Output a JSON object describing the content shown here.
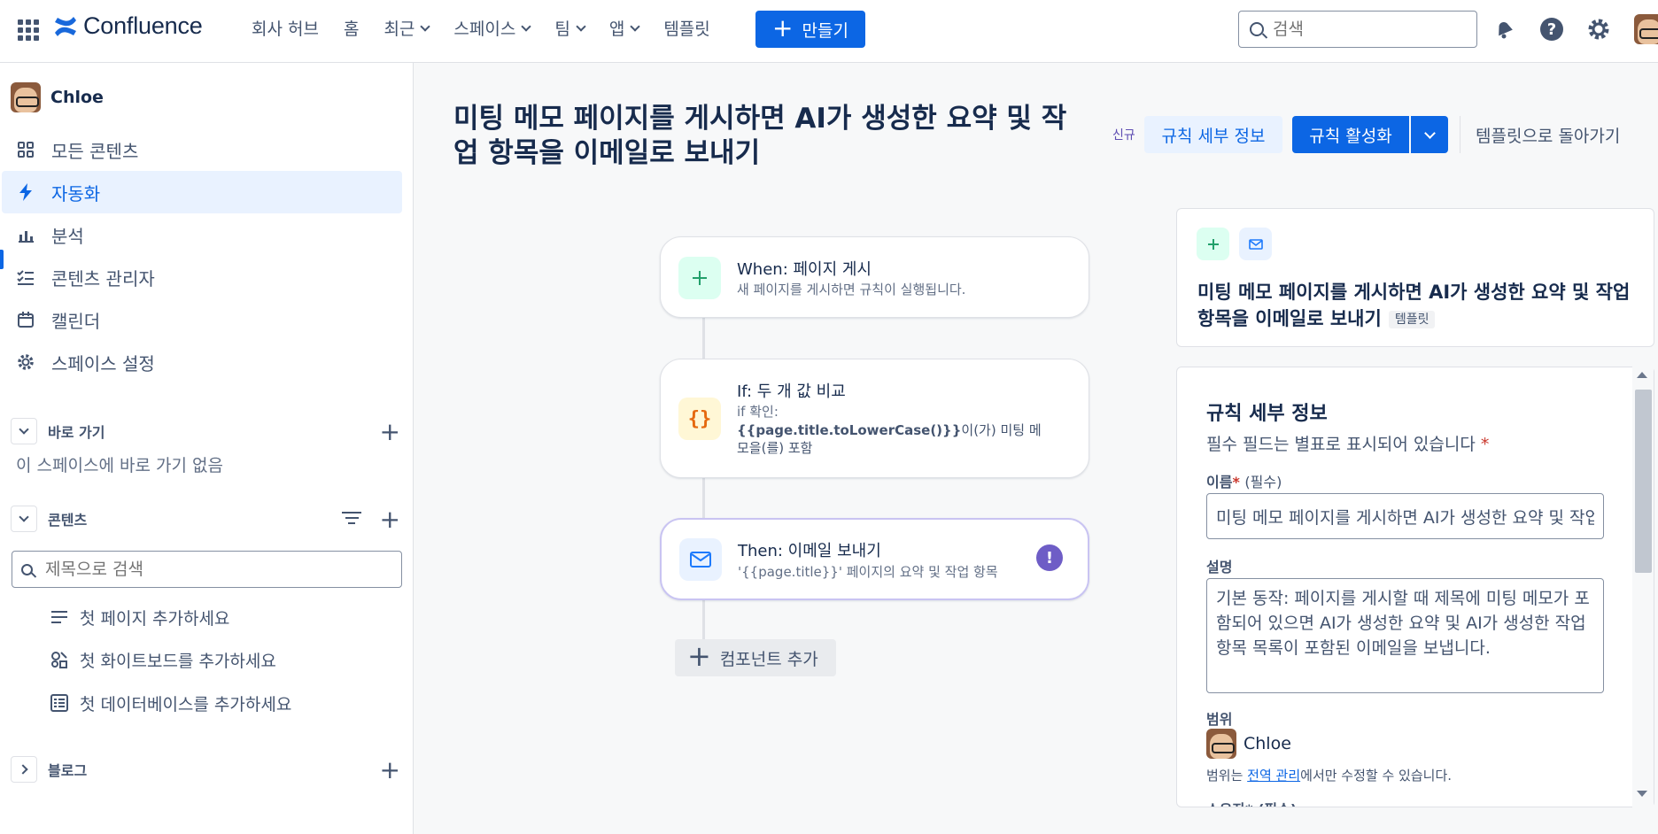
{
  "topnav": {
    "app_name": "Confluence",
    "items": [
      {
        "label": "회사 허브",
        "dropdown": false
      },
      {
        "label": "홈",
        "dropdown": false
      },
      {
        "label": "최근",
        "dropdown": true
      },
      {
        "label": "스페이스",
        "dropdown": true
      },
      {
        "label": "팀",
        "dropdown": true
      },
      {
        "label": "앱",
        "dropdown": true
      },
      {
        "label": "템플릿",
        "dropdown": false
      }
    ],
    "create_label": "만들기",
    "search_placeholder": "검색",
    "icons": [
      "app-switcher-icon",
      "notifications-icon",
      "help-icon",
      "settings-icon",
      "profile-avatar"
    ]
  },
  "sidebar": {
    "space_name": "Chloe",
    "nav": [
      {
        "label": "모든 콘텐츠",
        "icon": "all-content-icon"
      },
      {
        "label": "자동화",
        "icon": "lightning-icon",
        "active": true
      },
      {
        "label": "분석",
        "icon": "bar-chart-icon"
      },
      {
        "label": "콘텐츠 관리자",
        "icon": "checklist-icon"
      },
      {
        "label": "캘린더",
        "icon": "calendar-icon"
      },
      {
        "label": "스페이스 설정",
        "icon": "gear-icon"
      }
    ],
    "shortcuts_label": "바로 가기",
    "shortcuts_empty": "이 스페이스에 바로 가기 없음",
    "content_label": "콘텐츠",
    "content_search_placeholder": "제목으로 검색",
    "content_items": [
      {
        "label": "첫 페이지 추가하세요",
        "icon": "page-icon"
      },
      {
        "label": "첫 화이트보드를 추가하세요",
        "icon": "whiteboard-icon"
      },
      {
        "label": "첫 데이터베이스를 추가하세요",
        "icon": "database-icon"
      }
    ],
    "blog_label": "블로그"
  },
  "main": {
    "title": "미팅 메모 페이지를 게시하면 AI가 생성한 요약 및 작업 항목을 이메일로 보내기",
    "new_badge": "신규",
    "rule_details_button": "규칙 세부 정보",
    "activate_button": "규칙 활성화",
    "back_button": "템플릿으로 돌아가기"
  },
  "flow": {
    "trigger": {
      "title": "When: 페이지 게시",
      "subtitle": "새 페이지를 게시하면 규칙이 실행됩니다."
    },
    "condition": {
      "title": "If: 두 개 값 비교",
      "check_label": "if 확인:",
      "code": "{{page.title.toLowerCase()}}",
      "code_rest": "이(가) 미팅 메모을(를) 포함"
    },
    "action": {
      "title": "Then: 이메일 보내기",
      "subtitle": "'{{page.title}}' 페이지의 요약 및 작업 항목",
      "warning": "!"
    },
    "add_component": "컴포넌트 추가"
  },
  "summary_panel": {
    "title": "미팅 메모 페이지를 게시하면 AI가 생성한 요약 및 작업 항목을 이메일로 보내기",
    "tag": "템플릿"
  },
  "details_panel": {
    "heading": "규칙 세부 정보",
    "required_note": "필수 필드는 별표로 표시되어 있습니다",
    "required_mark": "*",
    "name_label": "이름",
    "name_required": "(필수)",
    "name_value": "미팅 메모 페이지를 게시하면 AI가 생성한 요약 및 작업 항목을 이메일로 보내기",
    "description_label": "설명",
    "description_value": "기본 동작: 페이지를 게시할 때 제목에 미팅 메모가 포함되어 있으면 AI가 생성한 요약 및 AI가 생성한 작업 항목 목록이 포함된 이메일을 보냅니다.",
    "scope_label": "범위",
    "scope_owner": "Chloe",
    "scope_note_before": "범위는 ",
    "scope_note_link": "전역 관리",
    "scope_note_after": "에서만 수정할 수 있습니다.",
    "next_label_cut": "소유자* (필수)"
  },
  "colors": {
    "brand_blue": "#0c66e4",
    "active_bg": "#e9f2ff",
    "trigger_green": "#22a06b",
    "condition_orange": "#e56910",
    "action_blue": "#1d7afc",
    "warning_purple": "#6e5dc6"
  }
}
